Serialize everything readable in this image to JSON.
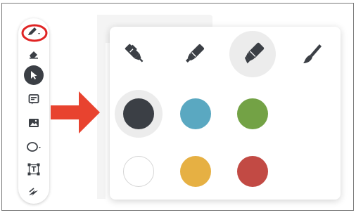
{
  "toolbar": {
    "tools": [
      {
        "name": "pen-tool",
        "icon": "pen-icon",
        "circled": true
      },
      {
        "name": "eraser-tool",
        "icon": "eraser-icon"
      },
      {
        "name": "select-tool",
        "icon": "cursor-icon",
        "active": true
      },
      {
        "name": "sticky-note-tool",
        "icon": "note-icon"
      },
      {
        "name": "image-tool",
        "icon": "image-icon"
      },
      {
        "name": "shape-tool",
        "icon": "circle-icon"
      },
      {
        "name": "text-tool",
        "icon": "text-frame-icon"
      },
      {
        "name": "lightning-tool",
        "icon": "lightning-icon"
      }
    ],
    "highlight_color": "#e02424"
  },
  "callout_arrow_color": "#e8432f",
  "pen_panel": {
    "pens": [
      {
        "name": "fine-pen",
        "icon": "fine-pen-icon"
      },
      {
        "name": "marker",
        "icon": "marker-icon"
      },
      {
        "name": "highlighter",
        "icon": "highlighter-icon",
        "selected": true
      },
      {
        "name": "brush",
        "icon": "brush-icon"
      }
    ],
    "colors": [
      {
        "name": "charcoal",
        "hex": "#3b3f45",
        "selected": true
      },
      {
        "name": "teal",
        "hex": "#5aa8c1"
      },
      {
        "name": "green",
        "hex": "#73a245"
      },
      {
        "name": "white",
        "hex": "#ffffff"
      },
      {
        "name": "yellow",
        "hex": "#e6b043"
      },
      {
        "name": "red",
        "hex": "#c24a44"
      }
    ]
  }
}
